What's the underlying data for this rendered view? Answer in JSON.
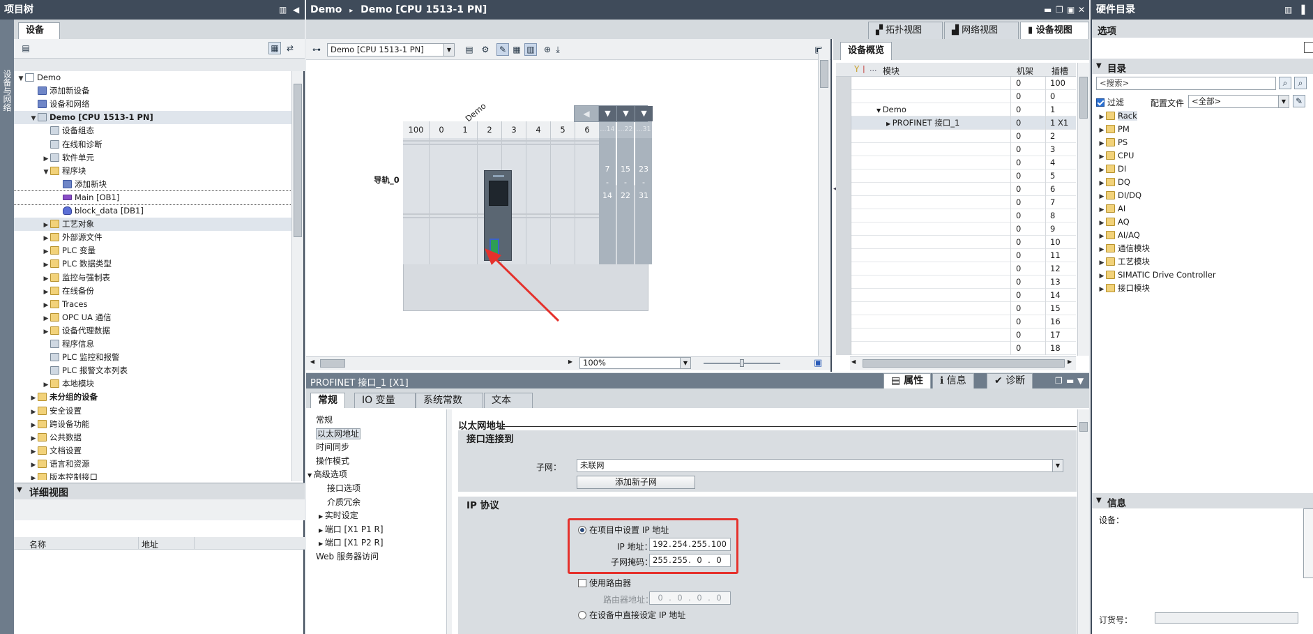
{
  "project_tree": {
    "title": "项目树",
    "tab": "设备",
    "items": [
      {
        "label": "Demo"
      },
      {
        "label": "添加新设备"
      },
      {
        "label": "设备和网络"
      },
      {
        "label": "Demo [CPU 1513-1 PN]"
      },
      {
        "label": "设备组态"
      },
      {
        "label": "在线和诊断"
      },
      {
        "label": "软件单元"
      },
      {
        "label": "程序块"
      },
      {
        "label": "添加新块"
      },
      {
        "label": "Main [OB1]"
      },
      {
        "label": "block_data [DB1]"
      },
      {
        "label": "工艺对象"
      },
      {
        "label": "外部源文件"
      },
      {
        "label": "PLC 变量"
      },
      {
        "label": "PLC 数据类型"
      },
      {
        "label": "监控与强制表"
      },
      {
        "label": "在线备份"
      },
      {
        "label": "Traces"
      },
      {
        "label": "OPC UA 通信"
      },
      {
        "label": "设备代理数据"
      },
      {
        "label": "程序信息"
      },
      {
        "label": "PLC 监控和报警"
      },
      {
        "label": "PLC 报警文本列表"
      },
      {
        "label": "本地模块"
      },
      {
        "label": "未分组的设备"
      },
      {
        "label": "安全设置"
      },
      {
        "label": "跨设备功能"
      },
      {
        "label": "公共数据"
      },
      {
        "label": "文档设置"
      },
      {
        "label": "语言和资源"
      },
      {
        "label": "版本控制接口"
      }
    ],
    "side_label": "设备与网络"
  },
  "detail_view": {
    "title": "详细视图",
    "col_name": "名称",
    "col_address": "地址"
  },
  "editor": {
    "title": "Demo",
    "title_sep": "▸",
    "title_device": "Demo [CPU 1513-1 PN]",
    "view_tabs": [
      "拓扑视图",
      "网络视图",
      "设备视图"
    ],
    "device_select": "Demo [CPU 1513-1 PN]",
    "device_label": "Demo",
    "rail_label": "导轨_0",
    "slot_numbers": [
      "100",
      "0",
      "1",
      "2",
      "3",
      "4",
      "5",
      "6"
    ],
    "ext_slots": [
      "...14",
      "...22",
      "...31"
    ],
    "ext_ranges": [
      [
        "7",
        "-",
        "14"
      ],
      [
        "15",
        "-",
        "22"
      ],
      [
        "23",
        "-",
        "31"
      ]
    ],
    "zoom": "100%"
  },
  "overview": {
    "tab": "设备概览",
    "headers": {
      "module": "模块",
      "rack": "机架",
      "slot": "插槽"
    },
    "rows": [
      {
        "module": "",
        "rack": "0",
        "slot": "100"
      },
      {
        "module": "",
        "rack": "0",
        "slot": "0"
      },
      {
        "module": "Demo",
        "rack": "0",
        "slot": "1"
      },
      {
        "module": "PROFINET 接口_1",
        "rack": "0",
        "slot": "1 X1"
      },
      {
        "module": "",
        "rack": "0",
        "slot": "2"
      },
      {
        "module": "",
        "rack": "0",
        "slot": "3"
      },
      {
        "module": "",
        "rack": "0",
        "slot": "4"
      },
      {
        "module": "",
        "rack": "0",
        "slot": "5"
      },
      {
        "module": "",
        "rack": "0",
        "slot": "6"
      },
      {
        "module": "",
        "rack": "0",
        "slot": "7"
      },
      {
        "module": "",
        "rack": "0",
        "slot": "8"
      },
      {
        "module": "",
        "rack": "0",
        "slot": "9"
      },
      {
        "module": "",
        "rack": "0",
        "slot": "10"
      },
      {
        "module": "",
        "rack": "0",
        "slot": "11"
      },
      {
        "module": "",
        "rack": "0",
        "slot": "12"
      },
      {
        "module": "",
        "rack": "0",
        "slot": "13"
      },
      {
        "module": "",
        "rack": "0",
        "slot": "14"
      },
      {
        "module": "",
        "rack": "0",
        "slot": "15"
      },
      {
        "module": "",
        "rack": "0",
        "slot": "16"
      },
      {
        "module": "",
        "rack": "0",
        "slot": "17"
      },
      {
        "module": "",
        "rack": "0",
        "slot": "18"
      }
    ]
  },
  "props": {
    "title": "PROFINET 接口_1 [X1]",
    "top_tabs": [
      "属性",
      "信息",
      "诊断"
    ],
    "tabs": [
      "常规",
      "IO 变量",
      "系统常数",
      "文本"
    ],
    "nav": [
      "常规",
      "以太网地址",
      "时间同步",
      "操作模式",
      "高级选项",
      "接口选项",
      "介质冗余",
      "实时设定",
      "端口 [X1 P1 R]",
      "端口 [X1 P2 R]",
      "Web 服务器访问"
    ],
    "heading": "以太网地址",
    "sect_connect": "接口连接到",
    "subnet_label": "子网：",
    "subnet_value": "未联网",
    "add_subnet": "添加新子网",
    "sect_ip": "IP 协议",
    "radio_project": "在项目中设置 IP 地址",
    "ip_label": "IP 地址：",
    "ip_value": [
      "192",
      "254",
      "255",
      "100"
    ],
    "mask_label": "子网掩码：",
    "mask_value": [
      "255",
      "255",
      "0",
      "0"
    ],
    "use_router": "使用路由器",
    "router_label": "路由器地址：",
    "router_value": [
      "0",
      "0",
      "0",
      "0"
    ],
    "radio_device": "在设备中直接设定 IP 地址"
  },
  "catalog": {
    "title": "硬件目录",
    "options": "选项",
    "section": "目录",
    "search_placeholder": "<搜索>",
    "filter_label": "过滤",
    "profile_label": "配置文件",
    "profile_value": "<全部>",
    "items": [
      "Rack",
      "PM",
      "PS",
      "CPU",
      "DI",
      "DQ",
      "DI/DQ",
      "AI",
      "AQ",
      "AI/AQ",
      "通信模块",
      "工艺模块",
      "SIMATIC Drive Controller",
      "接口模块"
    ]
  },
  "info_panel": {
    "title": "信息",
    "device_label": "设备：",
    "order_label": "订货号："
  },
  "colors": {
    "titlebar": "#3f4b5a",
    "highlight": "#e5312c",
    "accent": "#2b4a7b"
  }
}
